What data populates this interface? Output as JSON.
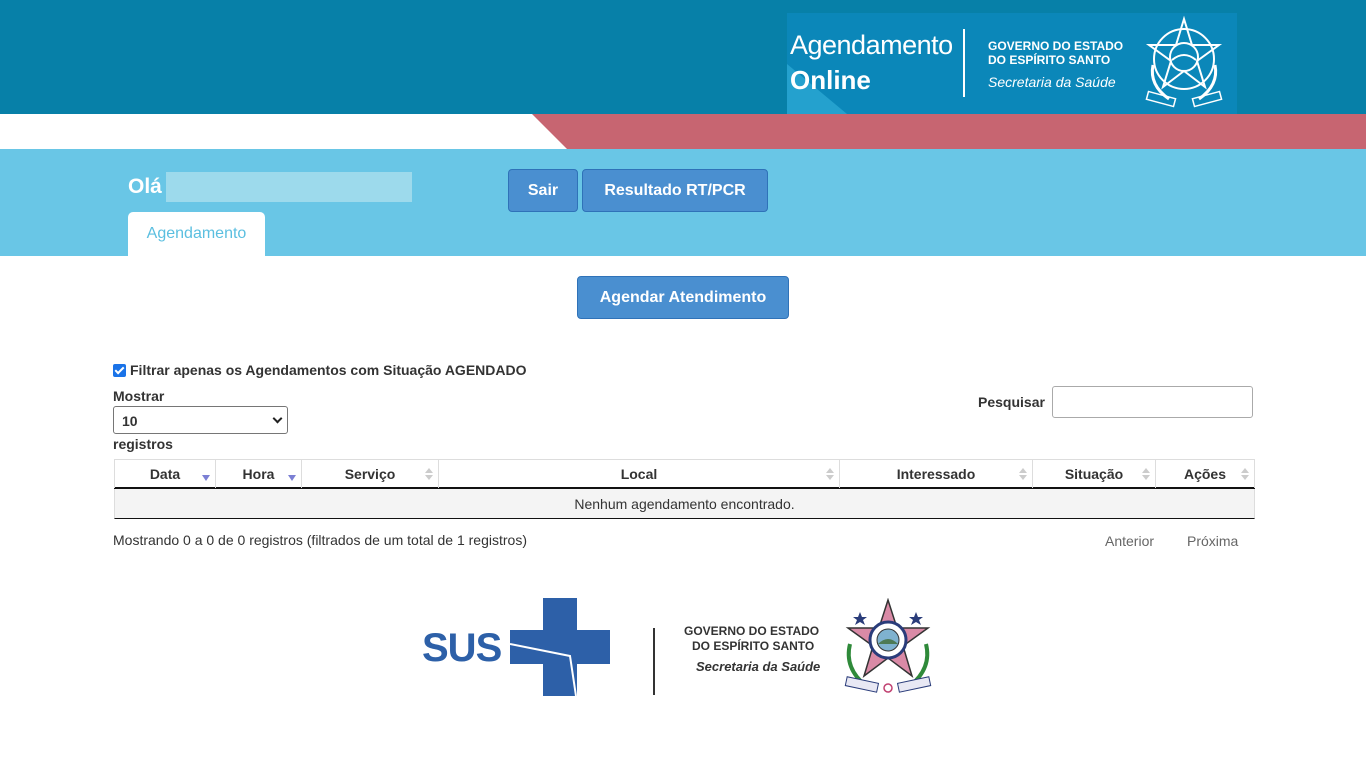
{
  "header": {
    "brand_title_line1": "Agendamento",
    "brand_title_line2": "Online",
    "gov_line1": "GOVERNO DO ESTADO",
    "gov_line2": "DO ESPÍRITO SANTO",
    "gov_line3": "Secretaria da Saúde"
  },
  "user_bar": {
    "greeting": "Olá",
    "logout_label": "Sair",
    "result_label": "Resultado RT/PCR",
    "tab_label": "Agendamento"
  },
  "main": {
    "schedule_button": "Agendar Atendimento",
    "filter_label": "Filtrar apenas os Agendamentos com Situação AGENDADO",
    "filter_checked": true,
    "show_label": "Mostrar",
    "page_size": "10",
    "records_label": "registros",
    "search_label": "Pesquisar",
    "search_value": "",
    "table": {
      "columns": [
        "Data",
        "Hora",
        "Serviço",
        "Local",
        "Interessado",
        "Situação",
        "Ações"
      ],
      "empty_message": "Nenhum agendamento encontrado."
    },
    "info_text": "Mostrando 0 a 0 de 0 registros (filtrados de um total de 1 registros)",
    "prev_label": "Anterior",
    "next_label": "Próxima"
  },
  "footer": {
    "sus_label": "SUS",
    "gov_line1": "GOVERNO DO ESTADO",
    "gov_line2": "DO ESPÍRITO SANTO",
    "gov_line3": "Secretaria da Saúde"
  },
  "colors": {
    "header_blue": "#0780a8",
    "light_blue": "#69c6e6",
    "button_blue": "#4a8fd0",
    "stripe_red": "#c76571",
    "sus_blue": "#2d60a8"
  }
}
